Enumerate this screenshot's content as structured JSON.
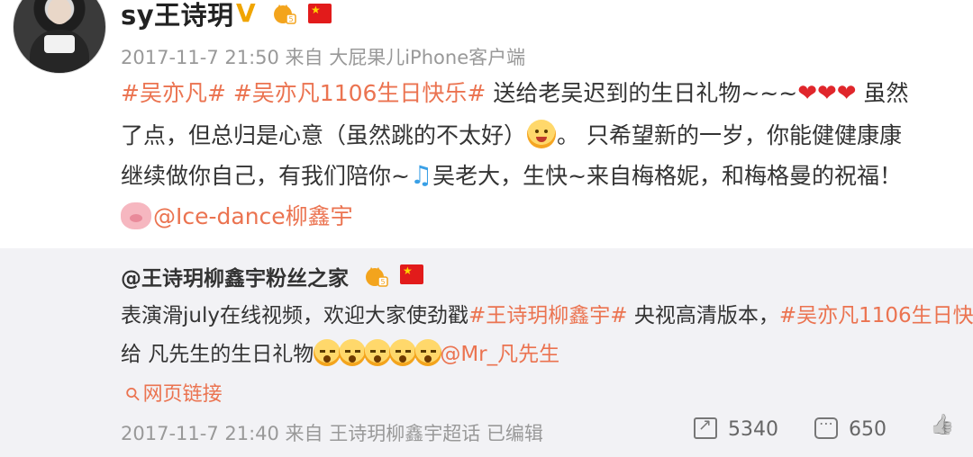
{
  "post": {
    "author": "sy王诗玥",
    "verified_icon": "verified-v-icon",
    "meta": "2017-11-7 21:50 来自 大屁果儿iPhone客户端",
    "line1": {
      "tag1": "#吴亦凡#",
      "tag2": "#吴亦凡1106生日快乐#",
      "text": " 送给老吴迟到的生日礼物~~~",
      "hearts": "❤❤❤",
      "tail": " 虽然"
    },
    "line2": {
      "text_a": "了点，但总归是心意（虽然跳的不太好）",
      "text_b": "。 只希望新的一岁，你能健健康康"
    },
    "line3": {
      "text_a": "继续做你自己，有我们陪你~",
      "note": "♫",
      "text_b": "吴老大，生快~来自梅格妮，和梅格曼的祝福！"
    },
    "line4": {
      "mention": "@Ice-dance柳鑫宇"
    }
  },
  "repost": {
    "author": "@王诗玥柳鑫宇粉丝之家",
    "line1": {
      "text_a": "表演滑july在线视频，欢迎大家使劲戳",
      "tag1": "#王诗玥柳鑫宇#",
      "text_b": " 央视高清版本，",
      "tag2": "#吴亦凡1106生日快"
    },
    "line2": {
      "text": "给 凡先生的生日礼物",
      "mention": "@Mr_凡先生"
    },
    "link_label": "网页链接",
    "meta": "2017-11-7 21:40 来自 王诗玥柳鑫宇超话  已编辑",
    "repost_count": "5340",
    "comment_count": "650",
    "like_label": ""
  },
  "colors": {
    "accent": "#eb7350",
    "heart": "#e0262b",
    "repost_bg": "#f2f2f5"
  }
}
